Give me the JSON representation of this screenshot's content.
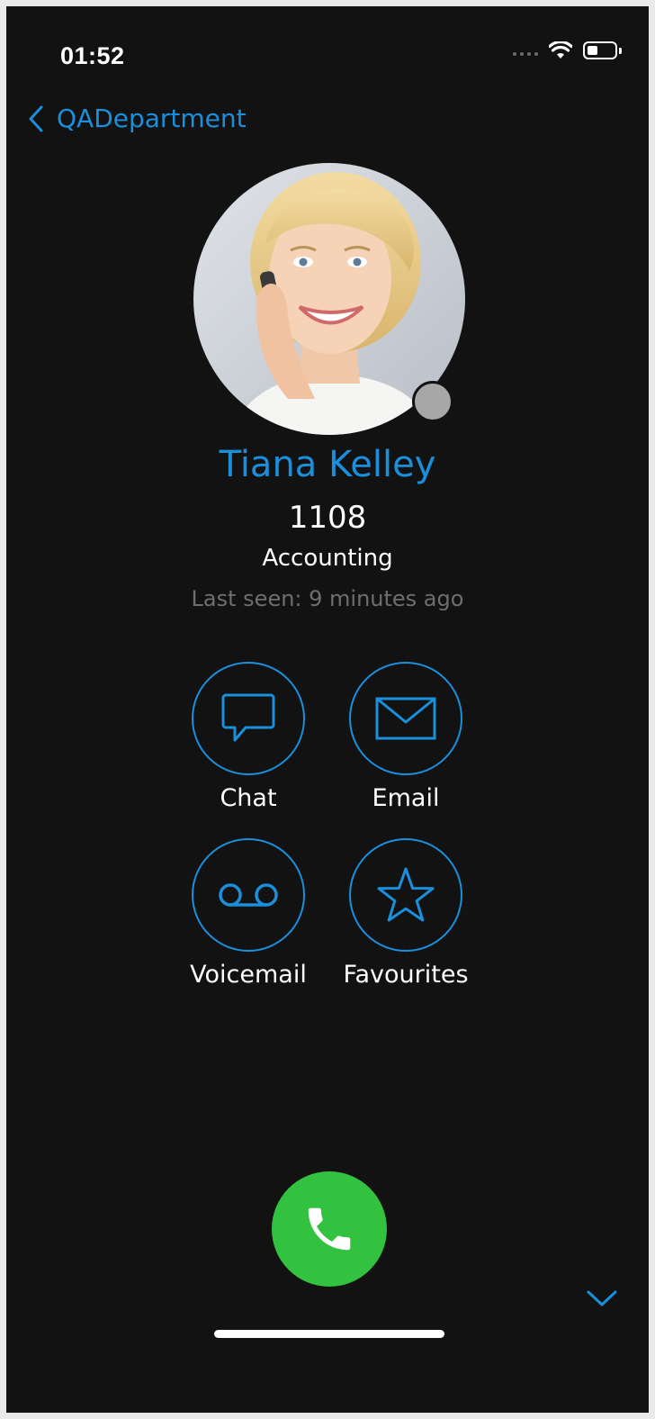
{
  "status_bar": {
    "time": "01:52",
    "icons": [
      "signal-dots-icon",
      "wifi-icon",
      "battery-icon"
    ]
  },
  "nav": {
    "back_label": "QADepartment",
    "back_icon": "chevron-left-icon"
  },
  "contact": {
    "name": "Tiana Kelley",
    "extension": "1108",
    "department": "Accounting",
    "last_seen": "Last seen: 9 minutes ago",
    "presence_color": "#a7a7a7"
  },
  "actions": [
    {
      "label": "Chat",
      "icon": "chat-bubble-icon"
    },
    {
      "label": "Email",
      "icon": "envelope-icon"
    },
    {
      "label": "Voicemail",
      "icon": "voicemail-icon"
    },
    {
      "label": "Favourites",
      "icon": "star-icon"
    }
  ],
  "call": {
    "icon": "phone-icon",
    "color": "#33c23f"
  },
  "colors": {
    "accent": "#1a8fdc",
    "background": "#121212",
    "muted_text": "#6e6e6e"
  }
}
